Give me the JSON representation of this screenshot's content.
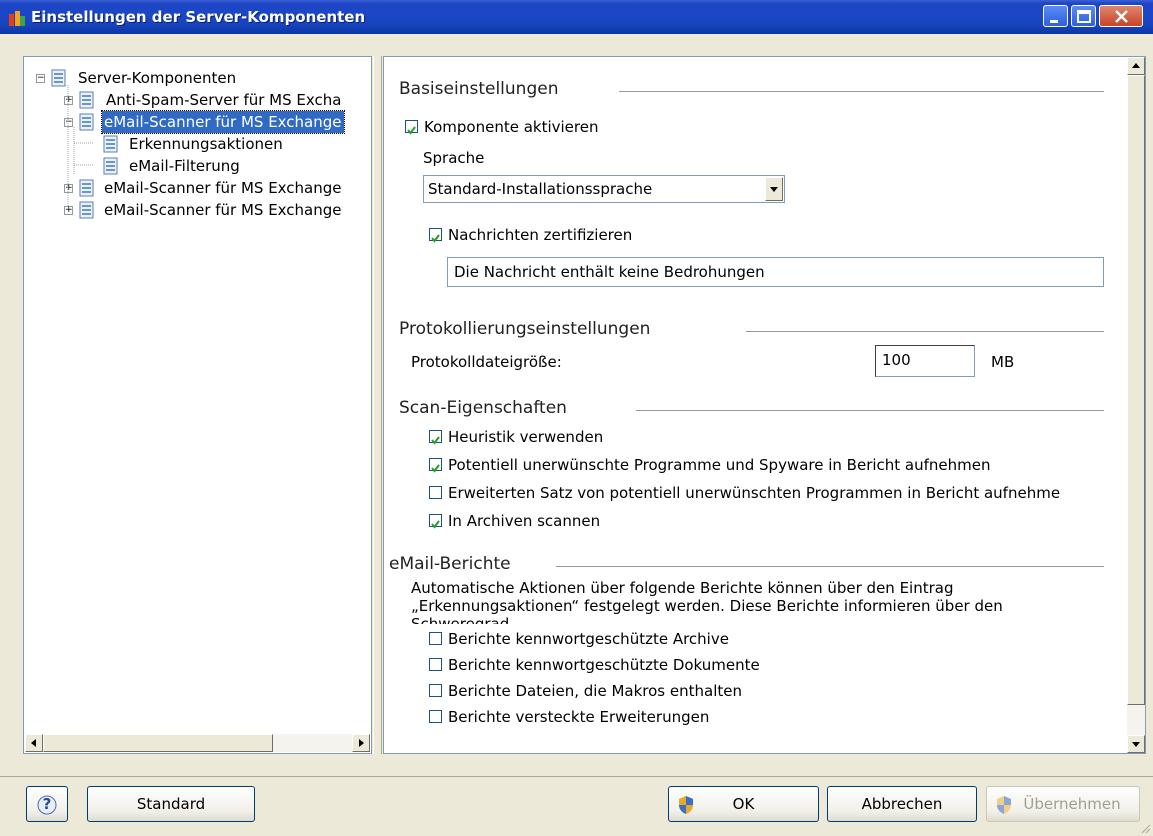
{
  "window": {
    "title": "Einstellungen der Server-Komponenten"
  },
  "tree": {
    "root": "Server-Komponenten",
    "items": [
      {
        "label": "Anti-Spam-Server für MS Excha",
        "expander": "+"
      },
      {
        "label": "eMail-Scanner für MS Exchange",
        "expander": "−"
      },
      {
        "label": "Erkennungsaktionen"
      },
      {
        "label": "eMail-Filterung"
      },
      {
        "label": "eMail-Scanner für MS Exchange",
        "expander": "+"
      },
      {
        "label": "eMail-Scanner für MS Exchange",
        "expander": "+"
      }
    ]
  },
  "basis": {
    "heading": "Basiseinstellungen",
    "activate_label": "Komponente aktivieren",
    "activate_checked": true,
    "language_label": "Sprache",
    "language_value": "Standard-Installationssprache",
    "certify_label": "Nachrichten zertifizieren",
    "certify_checked": true,
    "certify_text": "Die Nachricht enthält keine Bedrohungen"
  },
  "logging": {
    "heading": "Protokollierungseinstellungen",
    "size_label": "Protokolldateigröße:",
    "size_value": "100",
    "size_unit": "MB"
  },
  "scan": {
    "heading": "Scan-Eigenschaften",
    "options": [
      {
        "label": "Heuristik verwenden",
        "checked": true
      },
      {
        "label": "Potentiell unerwünschte Programme und Spyware in Bericht aufnehmen",
        "checked": true
      },
      {
        "label": "Erweiterten Satz von potentiell unerwünschten Programmen in Bericht aufnehme",
        "checked": false
      },
      {
        "label": "In Archiven scannen",
        "checked": true
      }
    ]
  },
  "reports": {
    "heading": "eMail-Berichte",
    "description_line1": "Automatische Aktionen über folgende Berichte können über den Eintrag",
    "description_line2": "„Erkennungsaktionen“ festgelegt werden. Diese Berichte informieren über den",
    "description_line3": "Schweregrad.",
    "options": [
      {
        "label": "Berichte kennwortgeschützte Archive",
        "checked": false
      },
      {
        "label": "Berichte kennwortgeschützte Dokumente",
        "checked": false
      },
      {
        "label": "Berichte Dateien, die Makros enthalten",
        "checked": false
      },
      {
        "label": "Berichte versteckte Erweiterungen",
        "checked": false
      }
    ]
  },
  "buttons": {
    "help": "?",
    "standard": "Standard",
    "ok": "OK",
    "cancel": "Abbrechen",
    "apply": "Übernehmen"
  },
  "icons": {
    "title_icon": "avg-app-icon",
    "tree_icon": "component-list-icon",
    "shield_icon": "uac-shield-icon"
  }
}
